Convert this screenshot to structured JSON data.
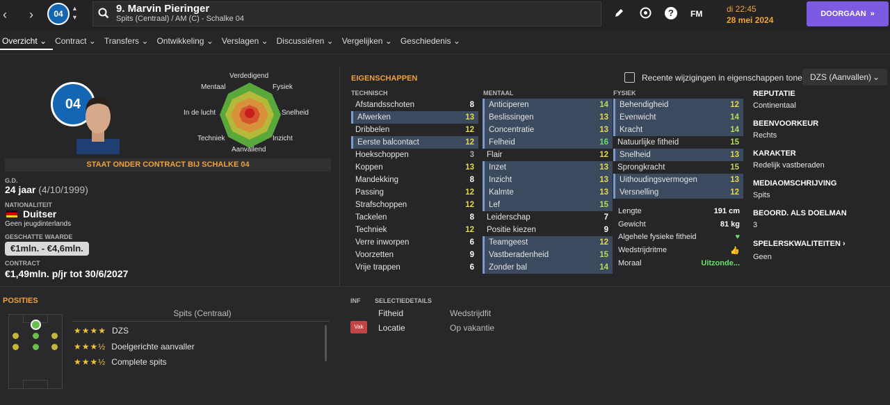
{
  "header": {
    "player_name": "9. Marvin Pieringer",
    "player_sub": "Spits (Centraal) / AM (C) - Schalke 04",
    "club_short": "04",
    "fm_label": "FM",
    "help_label": "?",
    "date_line1": "di 22:45",
    "date_line2": "28 mei 2024",
    "continue_label": "DOORGAAN",
    "continue_icon": "»",
    "back_icon": "‹",
    "forward_icon": "›"
  },
  "tabs": [
    "Overzicht ⌄",
    "Contract ⌄",
    "Transfers ⌄",
    "Ontwikkeling ⌄",
    "Verslagen ⌄",
    "Discussiëren ⌄",
    "Vergelijken ⌄",
    "Geschiedenis ⌄"
  ],
  "radar": {
    "labels": {
      "top": "Verdedigend",
      "tl": "Mentaal",
      "tr": "Fysiek",
      "l": "In de lucht",
      "r": "Snelheid",
      "bl": "Techniek",
      "br": "Inzicht",
      "bottom": "Aanvallend"
    }
  },
  "profile": {
    "contract_banner": "STAAT ONDER CONTRACT BIJ SCHALKE 04",
    "dob_label": "G.D.",
    "age": "24 jaar",
    "dob": "(4/10/1999)",
    "nat_label": "NATIONALITEIT",
    "nationality": "Duitser",
    "youth_caps": "Geen jeugdinterlands",
    "value_label": "GESCHATTE WAARDE",
    "value": "€1mln. - €4,6mln.",
    "contract_label": "CONTRACT",
    "contract": "€1,49mln. p/jr tot 30/6/2027"
  },
  "attributes": {
    "title": "EIGENSCHAPPEN",
    "recent_label": "Recente wijzigingen in eigenschappen tonen",
    "dropdown": "DZS (Aanvallen)",
    "technisch_header": "TECHNISCH",
    "mentaal_header": "MENTAAL",
    "fysiek_header": "FYSIEK",
    "technisch": [
      {
        "name": "Afstandsschoten",
        "value": "8"
      },
      {
        "name": "Afwerken",
        "value": "13"
      },
      {
        "name": "Dribbelen",
        "value": "12"
      },
      {
        "name": "Eerste balcontact",
        "value": "12"
      },
      {
        "name": "Hoekschoppen",
        "value": "3"
      },
      {
        "name": "Koppen",
        "value": "13"
      },
      {
        "name": "Mandekking",
        "value": "8"
      },
      {
        "name": "Passing",
        "value": "12"
      },
      {
        "name": "Strafschoppen",
        "value": "12"
      },
      {
        "name": "Tackelen",
        "value": "8"
      },
      {
        "name": "Techniek",
        "value": "12"
      },
      {
        "name": "Verre inworpen",
        "value": "6"
      },
      {
        "name": "Voorzetten",
        "value": "9"
      },
      {
        "name": "Vrije trappen",
        "value": "6"
      }
    ],
    "mentaal": [
      {
        "name": "Anticiperen",
        "value": "14"
      },
      {
        "name": "Beslissingen",
        "value": "13"
      },
      {
        "name": "Concentratie",
        "value": "13"
      },
      {
        "name": "Felheid",
        "value": "16"
      },
      {
        "name": "Flair",
        "value": "12"
      },
      {
        "name": "Inzet",
        "value": "13"
      },
      {
        "name": "Inzicht",
        "value": "13"
      },
      {
        "name": "Kalmte",
        "value": "13"
      },
      {
        "name": "Lef",
        "value": "15"
      },
      {
        "name": "Leiderschap",
        "value": "7"
      },
      {
        "name": "Positie kiezen",
        "value": "9"
      },
      {
        "name": "Teamgeest",
        "value": "12"
      },
      {
        "name": "Vastberadenheid",
        "value": "15"
      },
      {
        "name": "Zonder bal",
        "value": "14"
      }
    ],
    "fysiek": [
      {
        "name": "Behendigheid",
        "value": "12"
      },
      {
        "name": "Evenwicht",
        "value": "14"
      },
      {
        "name": "Kracht",
        "value": "14"
      },
      {
        "name": "Natuurlijke fitheid",
        "value": "15"
      },
      {
        "name": "Snelheid",
        "value": "13"
      },
      {
        "name": "Sprongkracht",
        "value": "15"
      },
      {
        "name": "Uithoudingsvermogen",
        "value": "13"
      },
      {
        "name": "Versnelling",
        "value": "12"
      }
    ],
    "stats": [
      {
        "label": "Lengte",
        "value": "191 cm"
      },
      {
        "label": "Gewicht",
        "value": "81 kg"
      },
      {
        "label": "Algehele fysieke fitheid",
        "value": "♥"
      },
      {
        "label": "Wedstrijdritme",
        "value": "👍"
      },
      {
        "label": "Moraal",
        "value": "Uitzonde..."
      }
    ]
  },
  "right_info": {
    "rep_label": "REPUTATIE",
    "rep": "Continentaal",
    "foot_label": "BEENVOORKEUR",
    "foot": "Rechts",
    "char_label": "KARAKTER",
    "char": "Redelijk vastberaden",
    "media_label": "MEDIAOMSCHRIJVING",
    "media": "Spits",
    "gk_label": "BEOORD. ALS DOELMAN",
    "gk": "3",
    "traits_label": "SPELERSKWALITEITEN ›",
    "traits": "Geen"
  },
  "positions": {
    "title": "POSITIES",
    "current": "Spits (Centraal)",
    "roles": [
      {
        "stars": "★★★★",
        "name": "DZS"
      },
      {
        "stars": "★★★½",
        "name": "Doelgerichte aanvaller"
      },
      {
        "stars": "★★★½",
        "name": "Complete spits"
      }
    ]
  },
  "selection": {
    "inf_header": "INF",
    "details_header": "SELECTIEDETAILS",
    "rows": [
      {
        "label": "Fitheid",
        "value": "Wedstrijdfit"
      },
      {
        "label": "Locatie",
        "value": "Op vakantie"
      }
    ],
    "badge": "Vak"
  },
  "colors": {
    "accent": "#f0a33a",
    "button": "#7c5be2",
    "highlight": "#3b4a5e",
    "green": "#6be06b"
  }
}
